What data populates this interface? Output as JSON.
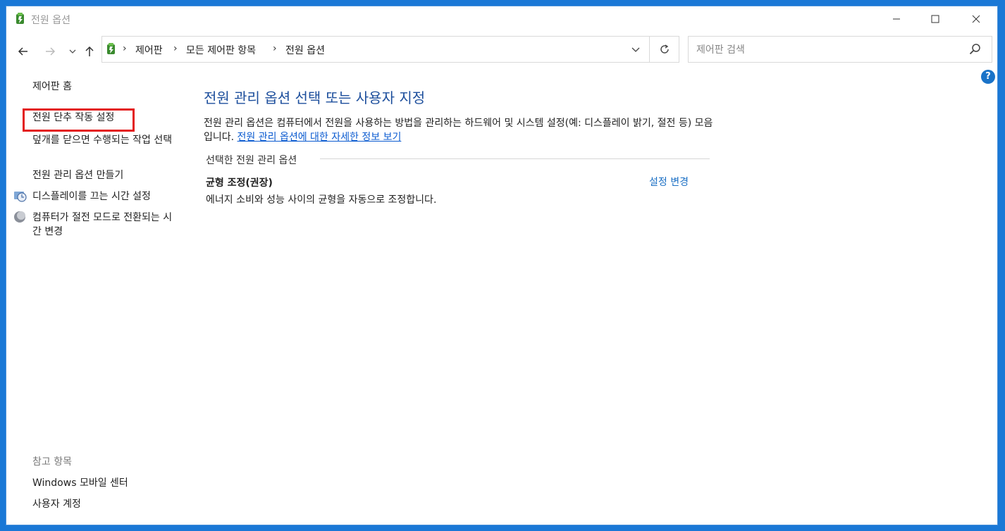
{
  "window": {
    "title": "전원 옵션"
  },
  "navigation": {
    "breadcrumbs": [
      "제어판",
      "모든 제어판 항목",
      "전원 옵션"
    ],
    "separator": "›"
  },
  "search": {
    "placeholder": "제어판 검색"
  },
  "sidebar": {
    "home": "제어판 홈",
    "items": [
      "전원 단추 작동 설정",
      "덮개를 닫으면 수행되는 작업 선택",
      "전원 관리 옵션 만들기",
      "디스플레이를 끄는 시간 설정",
      "컴퓨터가 절전 모드로 전환되는 시간 변경"
    ],
    "see_also_header": "참고 항목",
    "see_also": [
      "Windows 모바일 센터",
      "사용자 계정"
    ]
  },
  "main": {
    "title": "전원 관리 옵션 선택 또는 사용자 지정",
    "description": "전원 관리 옵션은 컴퓨터에서 전원을 사용하는 방법을 관리하는 하드웨어 및 시스템 설정(예: 디스플레이 밝기, 절전 등) 모음입니다.",
    "description_link": "전원 관리 옵션에 대한 자세한 정보 보기",
    "group_header": "선택한 전원 관리 옵션",
    "plan": {
      "name": "균형 조정(권장)",
      "change_label": "설정 변경",
      "description": "에너지 소비와 성능 사이의 균형을 자동으로 조정합니다."
    }
  },
  "colors": {
    "desktop": "#1a78d6",
    "title_blue": "#1c4e9c",
    "link_blue": "#0b5bd0",
    "highlight_red": "#e31b1b"
  },
  "icons": [
    "power-options-icon",
    "minimize-icon",
    "maximize-icon",
    "close-icon",
    "back-arrow-icon",
    "forward-arrow-icon",
    "recent-dropdown-icon",
    "up-arrow-icon",
    "chevron-down-icon",
    "refresh-icon",
    "search-icon",
    "help-icon",
    "display-clock-icon",
    "sleep-moon-icon"
  ]
}
